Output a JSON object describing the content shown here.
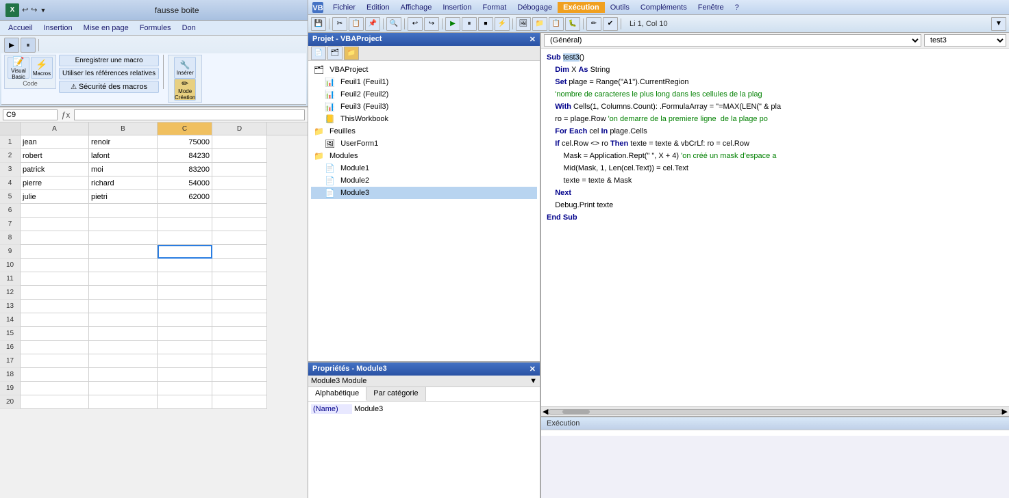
{
  "excel": {
    "title": "fausse boite",
    "menu_items": [
      "Accueil",
      "Insertion",
      "Mise en page",
      "Formules",
      "Don"
    ],
    "ribbon_groups": {
      "code_label": "Code",
      "macro_label": "Macros",
      "visual_basic_label": "Visual\nBasic",
      "macros_label": "Macros",
      "enregistrer_label": "Enregistrer une macro",
      "references_label": "Utiliser les références relatives",
      "securite_label": "Sécurité des macros",
      "inserer_label": "Insérer",
      "mode_creation_label": "Mode\nCréation"
    },
    "name_box": "C9",
    "formula_input": "",
    "col_headers": [
      "A",
      "B",
      "C",
      "D"
    ],
    "rows": [
      {
        "num": 1,
        "a": "jean",
        "b": "renoir",
        "c": "75000",
        "d": ""
      },
      {
        "num": 2,
        "a": "robert",
        "b": "lafont",
        "c": "84230",
        "d": ""
      },
      {
        "num": 3,
        "a": "patrick",
        "b": "moi",
        "c": "83200",
        "d": ""
      },
      {
        "num": 4,
        "a": "pierre",
        "b": "richard",
        "c": "54000",
        "d": ""
      },
      {
        "num": 5,
        "a": "julie",
        "b": "pietri",
        "c": "62000",
        "d": ""
      },
      {
        "num": 6,
        "a": "",
        "b": "",
        "c": "",
        "d": ""
      },
      {
        "num": 7,
        "a": "",
        "b": "",
        "c": "",
        "d": ""
      },
      {
        "num": 8,
        "a": "",
        "b": "",
        "c": "",
        "d": ""
      },
      {
        "num": 9,
        "a": "",
        "b": "",
        "c": "",
        "d": ""
      },
      {
        "num": 10,
        "a": "",
        "b": "",
        "c": "",
        "d": ""
      },
      {
        "num": 11,
        "a": "",
        "b": "",
        "c": "",
        "d": ""
      },
      {
        "num": 12,
        "a": "",
        "b": "",
        "c": "",
        "d": ""
      },
      {
        "num": 13,
        "a": "",
        "b": "",
        "c": "",
        "d": ""
      },
      {
        "num": 14,
        "a": "",
        "b": "",
        "c": "",
        "d": ""
      },
      {
        "num": 15,
        "a": "",
        "b": "",
        "c": "",
        "d": ""
      },
      {
        "num": 16,
        "a": "",
        "b": "",
        "c": "",
        "d": ""
      },
      {
        "num": 17,
        "a": "",
        "b": "",
        "c": "",
        "d": ""
      },
      {
        "num": 18,
        "a": "",
        "b": "",
        "c": "",
        "d": ""
      },
      {
        "num": 19,
        "a": "",
        "b": "",
        "c": "",
        "d": ""
      },
      {
        "num": 20,
        "a": "",
        "b": "",
        "c": "",
        "d": ""
      }
    ]
  },
  "vba": {
    "menu_items": [
      "Fichier",
      "Edition",
      "Affichage",
      "Insertion",
      "Format",
      "Débogage",
      "Exécution",
      "Outils",
      "Compléments",
      "Fenêtre",
      "?"
    ],
    "active_menu": "Exécution",
    "toolbar_li_info": "Li 1, Col 10",
    "project_title": "Projet - VBAProject",
    "module_dropdown": "(Général)",
    "proc_dropdown": "test3",
    "project_tree": [
      {
        "indent": 0,
        "type": "project",
        "label": "VBAProject"
      },
      {
        "indent": 1,
        "type": "sheet",
        "label": "Feuil1 (Feuil1)"
      },
      {
        "indent": 1,
        "type": "sheet",
        "label": "Feuil2 (Feuil2)"
      },
      {
        "indent": 1,
        "type": "sheet",
        "label": "Feuil3 (Feuil3)"
      },
      {
        "indent": 1,
        "type": "sheet",
        "label": "ThisWorkbook"
      },
      {
        "indent": 0,
        "type": "folder",
        "label": "Feuilles"
      },
      {
        "indent": 1,
        "type": "form",
        "label": "UserForm1"
      },
      {
        "indent": 0,
        "type": "folder",
        "label": "Modules"
      },
      {
        "indent": 1,
        "type": "module",
        "label": "Module1"
      },
      {
        "indent": 1,
        "type": "module",
        "label": "Module2"
      },
      {
        "indent": 1,
        "type": "module",
        "label": "Module3"
      }
    ],
    "props_title": "Propriétés - Module3",
    "props_module": "Module3 Module",
    "props_tabs": [
      "Alphabétique",
      "Par catégorie"
    ],
    "props_name_label": "(Name)",
    "props_name_value": "Module3",
    "code_lines": [
      {
        "text": "Sub test3()",
        "type": "normal",
        "sel": false
      },
      {
        "text": "    Dim X As String",
        "type": "normal",
        "sel": false
      },
      {
        "text": "    Set plage = Range(\"A1\").CurrentRegion",
        "type": "normal",
        "sel": false
      },
      {
        "text": "    'nombre de caracteres le plus long dans les cellules de la plag",
        "type": "comment",
        "sel": false
      },
      {
        "text": "    With Cells(1, Columns.Count): .FormulaArray = \"=MAX(LEN(\" & pla",
        "type": "normal",
        "sel": false
      },
      {
        "text": "    ro = plage.Row 'on demarre de la premiere ligne  de la plage po",
        "type": "normal",
        "sel": false
      },
      {
        "text": "    For Each cel In plage.Cells",
        "type": "normal",
        "sel": false
      },
      {
        "text": "    If cel.Row <> ro Then texte = texte & vbCrLf: ro = cel.Row",
        "type": "if_line",
        "sel": false
      },
      {
        "text": "        Mask = Application.Rept(\" \", X + 4) 'on créé un mask d'espace a",
        "type": "normal",
        "sel": false
      },
      {
        "text": "        Mid(Mask, 1, Len(cel.Text)) = cel.Text",
        "type": "normal",
        "sel": false
      },
      {
        "text": "        texte = texte & Mask",
        "type": "normal",
        "sel": false
      },
      {
        "text": "    Next",
        "type": "normal",
        "sel": false
      },
      {
        "text": "    Debug.Print texte",
        "type": "normal",
        "sel": false
      },
      {
        "text": "End Sub",
        "type": "normal",
        "sel": false
      }
    ],
    "exec_title": "Exécution",
    "selected_sub": "test3"
  }
}
